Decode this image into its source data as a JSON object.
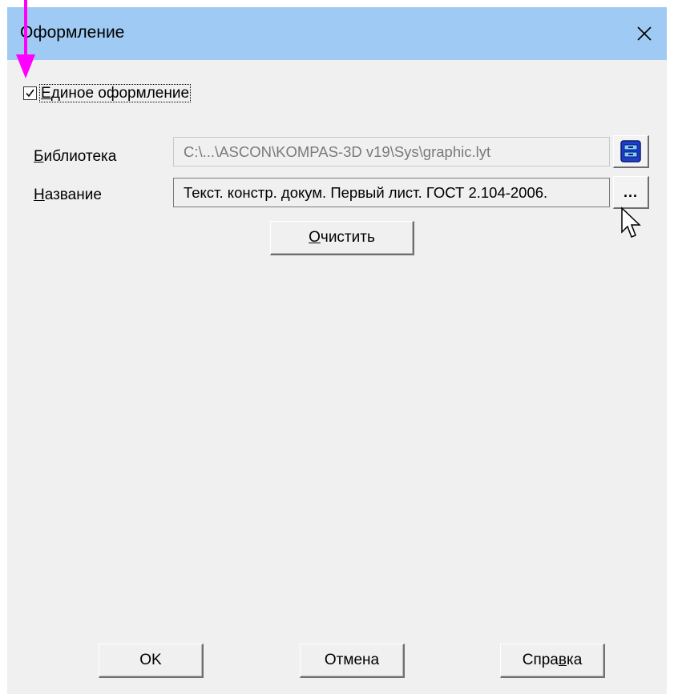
{
  "dialog": {
    "title": "Оформление",
    "close_glyph": "✕"
  },
  "unified_style": {
    "label": "Единое оформление",
    "checked": true
  },
  "library": {
    "label": "Библиотека",
    "value": "C:\\...\\ASCON\\KOMPAS-3D v19\\Sys\\graphic.lyt",
    "button_icon": "library-icon"
  },
  "name": {
    "label": "Название",
    "value": "Текст. констр. докум. Первый лист. ГОСТ 2.104-2006.",
    "button_label": "..."
  },
  "clear_button": {
    "label": "Очистить"
  },
  "footer": {
    "ok": "OK",
    "cancel": "Отмена",
    "help": "Справка"
  },
  "colors": {
    "titlebar": "#9fcaf3",
    "annotation_arrow": "#ff00ff",
    "library_icon": "#1e3ec8"
  },
  "annotations": {
    "arrow_icon": "magenta-down-arrow"
  }
}
